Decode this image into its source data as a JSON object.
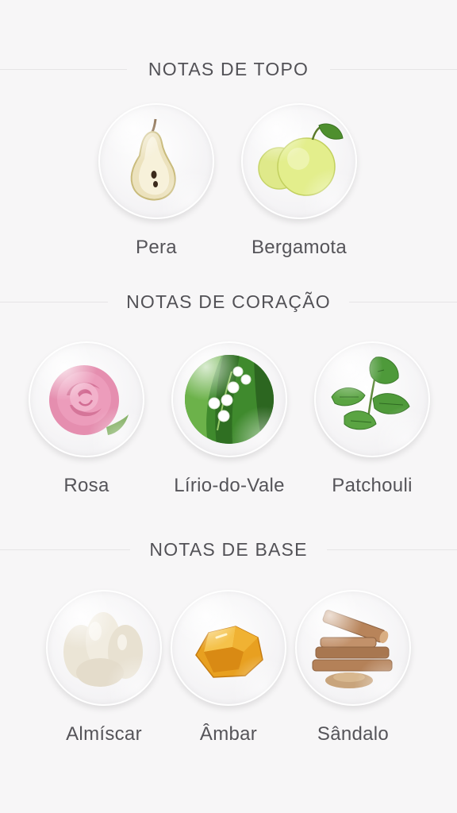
{
  "sections": [
    {
      "heading": "NOTAS DE TOPO",
      "notes": [
        {
          "label": "Pera",
          "icon": "pear-icon"
        },
        {
          "label": "Bergamota",
          "icon": "bergamot-icon"
        }
      ]
    },
    {
      "heading": "NOTAS DE CORAÇÃO",
      "notes": [
        {
          "label": "Rosa",
          "icon": "rose-icon"
        },
        {
          "label": "Lírio-do-Vale",
          "icon": "lily-of-the-valley-icon"
        },
        {
          "label": "Patchouli",
          "icon": "patchouli-icon"
        }
      ]
    },
    {
      "heading": "NOTAS DE BASE",
      "notes": [
        {
          "label": "Almíscar",
          "icon": "musk-icon"
        },
        {
          "label": "Âmbar",
          "icon": "amber-icon"
        },
        {
          "label": "Sândalo",
          "icon": "sandalwood-icon"
        }
      ]
    }
  ]
}
